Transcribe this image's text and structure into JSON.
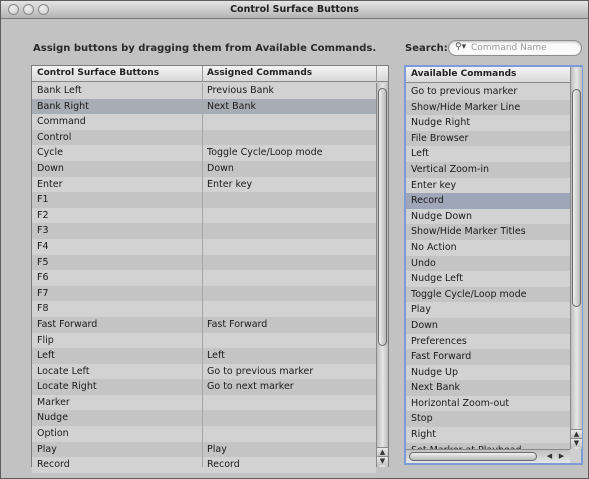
{
  "window": {
    "title": "Control Surface Buttons"
  },
  "instruction": "Assign buttons by dragging them from Available Commands.",
  "search": {
    "label": "Search:",
    "placeholder": "Command Name"
  },
  "assignments": {
    "columns": [
      "Control Surface Buttons",
      "Assigned Commands"
    ],
    "rows": [
      [
        "Bank Left",
        "Previous Bank"
      ],
      [
        "Bank Right",
        "Next Bank"
      ],
      [
        "Command",
        ""
      ],
      [
        "Control",
        ""
      ],
      [
        "Cycle",
        "Toggle Cycle/Loop mode"
      ],
      [
        "Down",
        "Down"
      ],
      [
        "Enter",
        "Enter key"
      ],
      [
        "F1",
        ""
      ],
      [
        "F2",
        ""
      ],
      [
        "F3",
        ""
      ],
      [
        "F4",
        ""
      ],
      [
        "F5",
        ""
      ],
      [
        "F6",
        ""
      ],
      [
        "F7",
        ""
      ],
      [
        "F8",
        ""
      ],
      [
        "Fast Forward",
        "Fast Forward"
      ],
      [
        "Flip",
        ""
      ],
      [
        "Left",
        "Left"
      ],
      [
        "Locate Left",
        "Go to previous marker"
      ],
      [
        "Locate Right",
        "Go to next marker"
      ],
      [
        "Marker",
        ""
      ],
      [
        "Nudge",
        ""
      ],
      [
        "Option",
        ""
      ],
      [
        "Play",
        "Play"
      ],
      [
        "Record",
        "Record"
      ]
    ],
    "selected_row": 1
  },
  "available": {
    "header": "Available Commands",
    "items": [
      "Go to previous marker",
      "Show/Hide Marker Line",
      "Nudge Right",
      "File Browser",
      "Left",
      "Vertical Zoom-in",
      "Enter key",
      "Record",
      "Nudge Down",
      "Show/Hide Marker Titles",
      "No Action",
      "Undo",
      "Nudge Left",
      "Toggle Cycle/Loop mode",
      "Play",
      "Down",
      "Preferences",
      "Fast Forward",
      "Nudge Up",
      "Next Bank",
      "Horizontal Zoom-out",
      "Stop",
      "Right",
      "Set Marker at Playhead"
    ],
    "selected_index": 7
  },
  "icons": {
    "search": "search-icon",
    "scroll_up": "scroll-up-arrow-icon",
    "scroll_down": "scroll-down-arrow-icon",
    "scroll_left": "scroll-left-arrow-icon",
    "scroll_right": "scroll-right-arrow-icon"
  }
}
